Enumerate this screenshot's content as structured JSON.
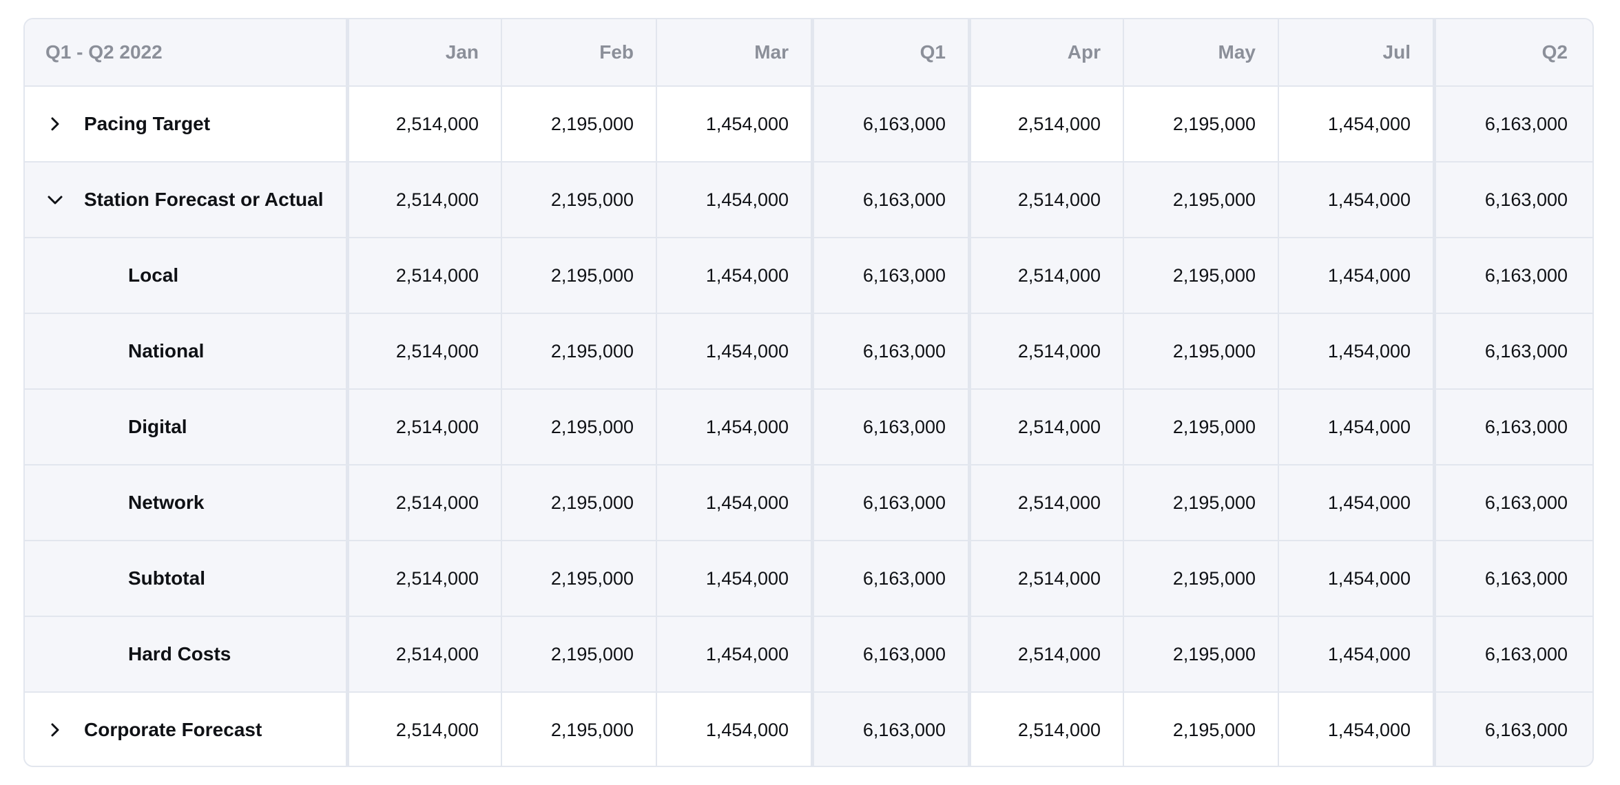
{
  "table": {
    "header": {
      "period": "Q1 - Q2 2022",
      "columns": [
        "Jan",
        "Feb",
        "Mar",
        "Q1",
        "Apr",
        "May",
        "Jul",
        "Q2"
      ]
    },
    "rows": [
      {
        "label": "Pacing Target",
        "expander": "chevron-right-icon",
        "values": [
          "2,514,000",
          "2,195,000",
          "1,454,000",
          "6,163,000",
          "2,514,000",
          "2,195,000",
          "1,454,000",
          "6,163,000"
        ]
      },
      {
        "label": "Station Forecast or Actual",
        "expander": "chevron-down-icon",
        "values": [
          "2,514,000",
          "2,195,000",
          "1,454,000",
          "6,163,000",
          "2,514,000",
          "2,195,000",
          "1,454,000",
          "6,163,000"
        ]
      },
      {
        "label": "Local",
        "values": [
          "2,514,000",
          "2,195,000",
          "1,454,000",
          "6,163,000",
          "2,514,000",
          "2,195,000",
          "1,454,000",
          "6,163,000"
        ]
      },
      {
        "label": "National",
        "values": [
          "2,514,000",
          "2,195,000",
          "1,454,000",
          "6,163,000",
          "2,514,000",
          "2,195,000",
          "1,454,000",
          "6,163,000"
        ]
      },
      {
        "label": "Digital",
        "values": [
          "2,514,000",
          "2,195,000",
          "1,454,000",
          "6,163,000",
          "2,514,000",
          "2,195,000",
          "1,454,000",
          "6,163,000"
        ]
      },
      {
        "label": "Network",
        "values": [
          "2,514,000",
          "2,195,000",
          "1,454,000",
          "6,163,000",
          "2,514,000",
          "2,195,000",
          "1,454,000",
          "6,163,000"
        ]
      },
      {
        "label": "Subtotal",
        "values": [
          "2,514,000",
          "2,195,000",
          "1,454,000",
          "6,163,000",
          "2,514,000",
          "2,195,000",
          "1,454,000",
          "6,163,000"
        ]
      },
      {
        "label": "Hard Costs",
        "values": [
          "2,514,000",
          "2,195,000",
          "1,454,000",
          "6,163,000",
          "2,514,000",
          "2,195,000",
          "1,454,000",
          "6,163,000"
        ]
      },
      {
        "label": "Corporate Forecast",
        "expander": "chevron-right-icon",
        "values": [
          "2,514,000",
          "2,195,000",
          "1,454,000",
          "6,163,000",
          "2,514,000",
          "2,195,000",
          "1,454,000",
          "6,163,000"
        ]
      }
    ]
  },
  "colors": {
    "border": "#e2e6ee",
    "header_text": "#8b8f99",
    "grey_row": "#f5f6fa",
    "highlight_column": "#e2e8f4"
  }
}
